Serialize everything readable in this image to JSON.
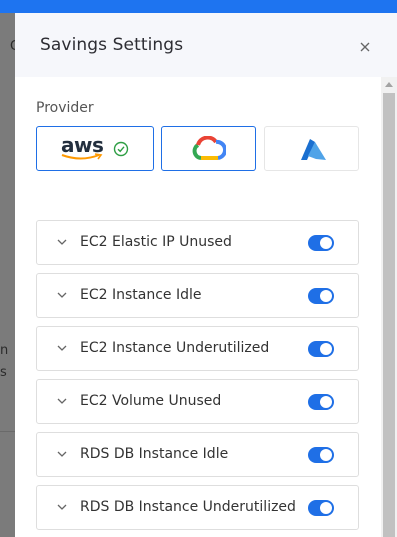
{
  "colors": {
    "accent": "#1f6fe6",
    "top_bar": "#1e74f0",
    "backdrop": "#7b7b7b",
    "header_bg": "#f6f7fb",
    "aws_check": "#2e9e44"
  },
  "backdrop": {
    "glyphs": [
      "C",
      "n",
      "s"
    ]
  },
  "drawer": {
    "title": "Savings Settings",
    "close_icon": "close-icon"
  },
  "provider": {
    "label": "Provider",
    "options": [
      {
        "name": "aws",
        "logo_text": "aws",
        "selected": true,
        "icon": "aws-logo-icon"
      },
      {
        "name": "gcp",
        "selected": true,
        "icon": "google-cloud-icon"
      },
      {
        "name": "azure",
        "selected": false,
        "icon": "azure-icon"
      }
    ]
  },
  "rules": [
    {
      "label": "EC2 Elastic IP Unused",
      "enabled": true
    },
    {
      "label": "EC2 Instance Idle",
      "enabled": true
    },
    {
      "label": "EC2 Instance Underutilized",
      "enabled": true
    },
    {
      "label": "EC2 Volume Unused",
      "enabled": true
    },
    {
      "label": "RDS DB Instance Idle",
      "enabled": true
    },
    {
      "label": "RDS DB Instance Underutilized",
      "enabled": true
    }
  ]
}
